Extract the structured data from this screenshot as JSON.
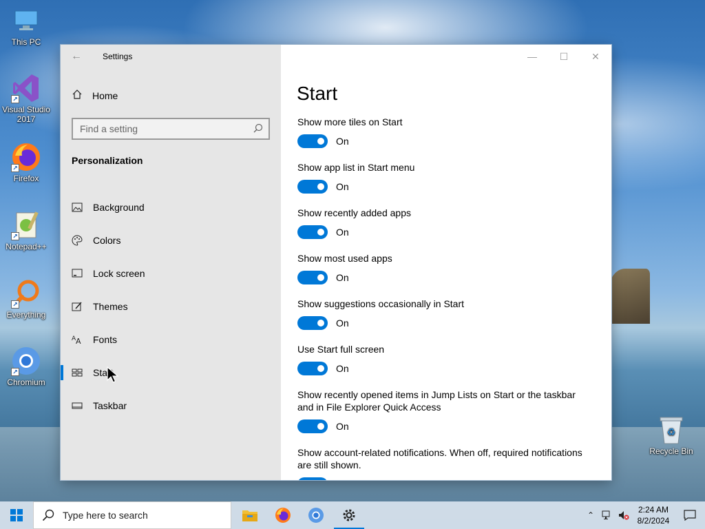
{
  "desktop": {
    "icons": [
      {
        "label": "This PC",
        "icon": "computer-icon"
      },
      {
        "label": "Visual Studio 2017",
        "icon": "visual-studio-icon"
      },
      {
        "label": "Firefox",
        "icon": "firefox-icon"
      },
      {
        "label": "Notepad++",
        "icon": "notepad-plus-plus-icon"
      },
      {
        "label": "Everything",
        "icon": "everything-search-icon"
      },
      {
        "label": "Chromium",
        "icon": "chromium-icon"
      },
      {
        "label": "Recycle Bin",
        "icon": "recycle-bin-icon"
      }
    ]
  },
  "window": {
    "app_title": "Settings",
    "back_icon": "back-arrow-icon",
    "nav": {
      "home_label": "Home",
      "search_placeholder": "Find a setting",
      "section_title": "Personalization",
      "items": [
        {
          "label": "Background",
          "icon": "picture-icon"
        },
        {
          "label": "Colors",
          "icon": "palette-icon"
        },
        {
          "label": "Lock screen",
          "icon": "lock-screen-icon"
        },
        {
          "label": "Themes",
          "icon": "themes-brush-icon"
        },
        {
          "label": "Fonts",
          "icon": "fonts-icon"
        },
        {
          "label": "Start",
          "icon": "start-tiles-icon",
          "active": true
        },
        {
          "label": "Taskbar",
          "icon": "taskbar-icon"
        }
      ]
    },
    "content": {
      "title": "Start",
      "settings": [
        {
          "label": "Show more tiles on Start",
          "state": "On"
        },
        {
          "label": "Show app list in Start menu",
          "state": "On"
        },
        {
          "label": "Show recently added apps",
          "state": "On"
        },
        {
          "label": "Show most used apps",
          "state": "On"
        },
        {
          "label": "Show suggestions occasionally in Start",
          "state": "On"
        },
        {
          "label": "Use Start full screen",
          "state": "On"
        },
        {
          "label": "Show recently opened items in Jump Lists on Start or the taskbar and in File Explorer Quick Access",
          "state": "On"
        },
        {
          "label": "Show account-related notifications. When off, required notifications are still shown.",
          "state": "On"
        }
      ]
    }
  },
  "taskbar": {
    "search_placeholder": "Type here to search",
    "apps": [
      {
        "name": "File Explorer",
        "icon": "file-explorer-icon"
      },
      {
        "name": "Firefox",
        "icon": "firefox-icon"
      },
      {
        "name": "Chromium",
        "icon": "chromium-icon"
      },
      {
        "name": "Settings",
        "icon": "gear-icon",
        "running": true
      }
    ],
    "clock_time": "2:24 AM",
    "clock_date": "8/2/2024"
  },
  "colors": {
    "accent": "#0078d7",
    "nav_bg": "#e6e6e6"
  }
}
